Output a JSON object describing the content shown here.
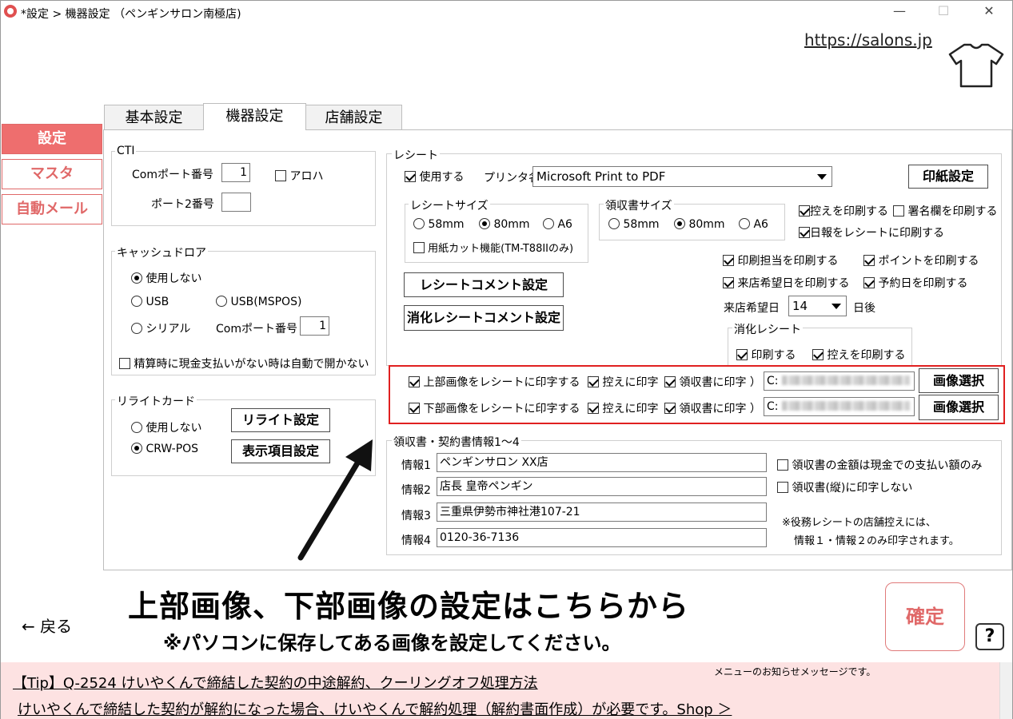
{
  "window": {
    "title": "*設定 > 機器設定 （ペンギンサロン南極店)",
    "min_label": "—",
    "max_label": "☐",
    "close_label": "✕"
  },
  "header": {
    "url": "https://salons.jp",
    "shirt_icon": "tshirt-icon"
  },
  "nav": {
    "items": [
      {
        "label": "設定",
        "active": true
      },
      {
        "label": "マスタ",
        "active": false
      },
      {
        "label": "自動メール",
        "active": false
      }
    ],
    "back_label": "← 戻る"
  },
  "tabs": [
    {
      "label": "基本設定",
      "active": false
    },
    {
      "label": "機器設定",
      "active": true
    },
    {
      "label": "店舗設定",
      "active": false
    }
  ],
  "cti": {
    "legend": "CTI",
    "com_label": "Comポート番号",
    "com_value": "1",
    "aloha_label": "アロハ",
    "aloha_checked": false,
    "port2_label": "ポート2番号",
    "port2_value": ""
  },
  "drawer": {
    "legend": "キャッシュドロア",
    "opt_none": "使用しない",
    "opt_usb": "USB",
    "opt_usb_mspos": "USB(MSPOS)",
    "opt_serial": "シリアル",
    "selected": "none",
    "com_label": "Comポート番号",
    "com_value": "1",
    "no_open_label": "精算時に現金支払いがない時は自動で開かない",
    "no_open_checked": false
  },
  "rewrite": {
    "legend": "リライトカード",
    "opt_none": "使用しない",
    "opt_crw": "CRW-POS",
    "selected": "crw",
    "setting_button": "リライト設定",
    "display_button": "表示項目設定"
  },
  "receipt": {
    "legend": "レシート",
    "use_label": "使用する",
    "use_checked": true,
    "printer_label": "プリンタ名",
    "printer_value": "Microsoft Print to PDF",
    "paper_button": "印紙設定",
    "receipt_size_legend": "レシートサイズ",
    "size_58": "58mm",
    "size_80": "80mm",
    "size_a6": "A6",
    "receipt_size_selected": "80mm",
    "cut_label": "用紙カット機能(TM-T88IIのみ)",
    "cut_checked": false,
    "ryoshu_size_legend": "領収書サイズ",
    "ryoshu_size_selected": "80mm",
    "print_copy_label": "控えを印刷する",
    "print_copy_checked": true,
    "signature_label": "署名欄を印刷する",
    "signature_checked": false,
    "daily_label": "日報をレシートに印刷する",
    "daily_checked": true,
    "staff_label": "印刷担当を印刷する",
    "staff_checked": true,
    "point_label": "ポイントを印刷する",
    "point_checked": true,
    "visit_date_label": "来店希望日を印刷する",
    "visit_date_checked": true,
    "reserve_date_label": "予約日を印刷する",
    "reserve_date_checked": true,
    "visit_date_field_label": "来店希望日",
    "visit_date_days": "14",
    "visit_date_suffix": "日後",
    "comment_button": "レシートコメント設定",
    "digest_comment_button": "消化レシートコメント設定",
    "digest_legend": "消化レシート",
    "digest_print_label": "印刷する",
    "digest_print_checked": true,
    "digest_copy_label": "控えを印刷する",
    "digest_copy_checked": true,
    "top_image_label": "上部画像をレシートに印字する（",
    "bottom_image_label": "下部画像をレシートに印字する（",
    "copy_print_label": "控えに印字",
    "ryoshu_print_label": "領収書に印字 ）",
    "top_path_value": "C:",
    "bottom_path_value": "C:",
    "image_select_button": "画像選択"
  },
  "info": {
    "legend": "領収書・契約書情報1～4",
    "rows": [
      {
        "label": "情報1",
        "value": "ペンギンサロン XX店"
      },
      {
        "label": "情報2",
        "value": "店長 皇帝ペンギン"
      },
      {
        "label": "情報3",
        "value": "三重県伊勢市神社港107-21"
      },
      {
        "label": "情報4",
        "value": "0120-36-7136"
      }
    ],
    "cash_only_label": "領収書の金額は現金での支払い額のみ",
    "cash_only_checked": false,
    "vertical_label": "領収書(縦)に印字しない",
    "vertical_checked": false,
    "note_line1": "※役務レシートの店舗控えには、",
    "note_line2": "情報１・情報２のみ印字されます。"
  },
  "annotation": {
    "main_text": "上部画像、下部画像の設定はこちらから",
    "sub_text": "※パソコンに保存してある画像を設定してください。",
    "arrow_icon": "arrow-icon"
  },
  "footer": {
    "confirm_label": "確定",
    "help_label": "?",
    "tip_title": "【Tip】Q-2524 けいやくんで締結した契約の中途解約、クーリングオフ処理方法",
    "tip_body": "けいやくんで締結した契約が解約になった場合、けいやくんで解約処理（解約書面作成）が必要です。Shop ＞",
    "tip_note": "メニューのお知らせメッセージです。"
  }
}
